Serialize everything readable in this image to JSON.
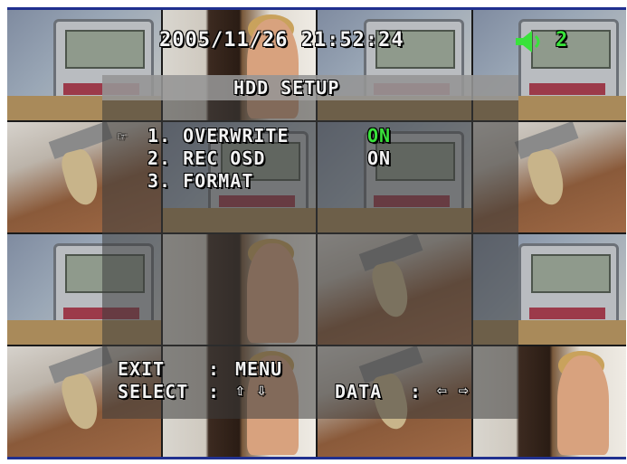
{
  "osd": {
    "datetime": "2005/11/26 21:52:24",
    "channel": "2",
    "title": "HDD SETUP",
    "cursor": "☞",
    "menu": [
      {
        "label": "1. OVERWRITE",
        "value": "ON"
      },
      {
        "label": "2. REC OSD",
        "value": "ON"
      },
      {
        "label": "3. FORMAT",
        "value": ""
      }
    ],
    "help": {
      "exit_label": "EXIT",
      "exit_sep": ":",
      "exit_key": "MENU",
      "select_label": "SELECT",
      "select_sep": ":",
      "select_keys": "⇧ ⇩",
      "data_label": "DATA",
      "data_sep": ":",
      "data_keys": "⇦ ⇨"
    }
  },
  "colors": {
    "accent_green": "#39e23b",
    "border_blue": "#20308f"
  },
  "icons": {
    "speaker": "speaker-icon",
    "cursor": "pointing-hand-icon"
  }
}
